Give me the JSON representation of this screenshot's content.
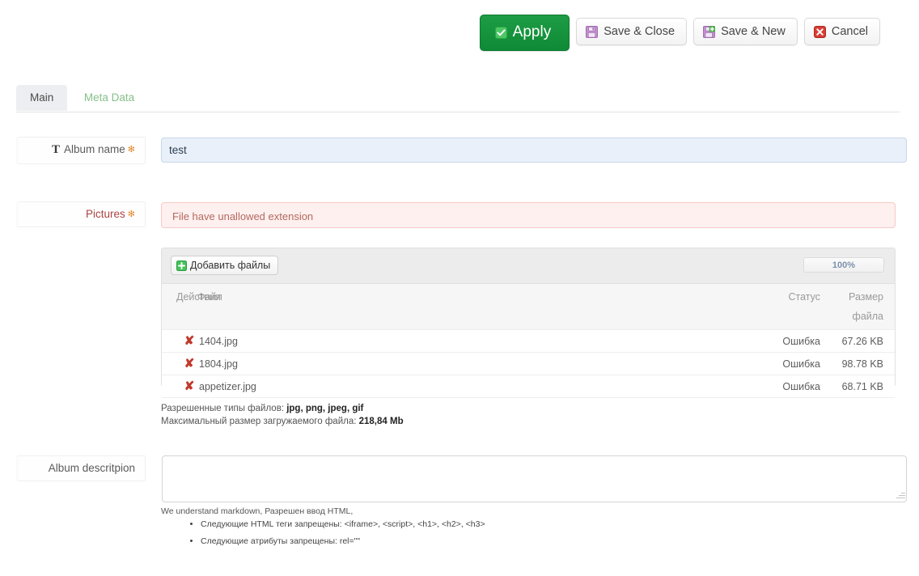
{
  "toolbar": {
    "apply": {
      "label": "Apply",
      "icon": "checkbox-checked-icon",
      "color": "#16903d"
    },
    "save_close": {
      "label": "Save & Close",
      "icon": "floppy-disk-icon"
    },
    "save_new": {
      "label": "Save & New",
      "icon": "floppy-disk-plus-icon"
    },
    "cancel": {
      "label": "Cancel",
      "icon": "close-x-icon",
      "color": "#cc2b26"
    }
  },
  "tabs": [
    {
      "label": "Main",
      "active": true
    },
    {
      "label": "Meta Data",
      "active": false
    }
  ],
  "fields": {
    "album_name": {
      "label": "Album name",
      "required_mark": "✻",
      "icon": "text-format-icon",
      "value": "test"
    },
    "pictures": {
      "label": "Pictures",
      "required_mark": "✻",
      "error": "File have unallowed extension"
    },
    "album_description": {
      "label": "Album descritpion",
      "value": ""
    }
  },
  "uploader": {
    "add_files_label": "Добавить файлы",
    "add_files_icon": "plus-square-icon",
    "progress_label": "100%",
    "progress_percent": 100,
    "columns": {
      "actions": "Действия",
      "file": "Файл",
      "status": "Статус",
      "size_line1": "Размер",
      "size_line2": "файла"
    },
    "rows": [
      {
        "name": "1404.jpg",
        "status": "Ошибка",
        "size": "67.26 KB",
        "remove_icon": "remove-x-icon"
      },
      {
        "name": "1804.jpg",
        "status": "Ошибка",
        "size": "98.78 KB",
        "remove_icon": "remove-x-icon"
      },
      {
        "name": "appetizer.jpg",
        "status": "Ошибка",
        "size": "68.71 KB",
        "remove_icon": "remove-x-icon"
      }
    ],
    "hint_types_prefix": "Разрешенные типы файлов: ",
    "hint_types_value": "jpg, png, jpeg, gif",
    "hint_size_prefix": "Максимальный размер загружаемого файла: ",
    "hint_size_value": "218,84 Mb"
  },
  "markdown_notes": {
    "intro": "We understand markdown, Разрешен ввод HTML,",
    "items": [
      "Следующие HTML теги запрещены: <iframe>, <script>, <h1>, <h2>, <h3>",
      "Следующие атрибуты запрещены: rel=\"\""
    ]
  }
}
